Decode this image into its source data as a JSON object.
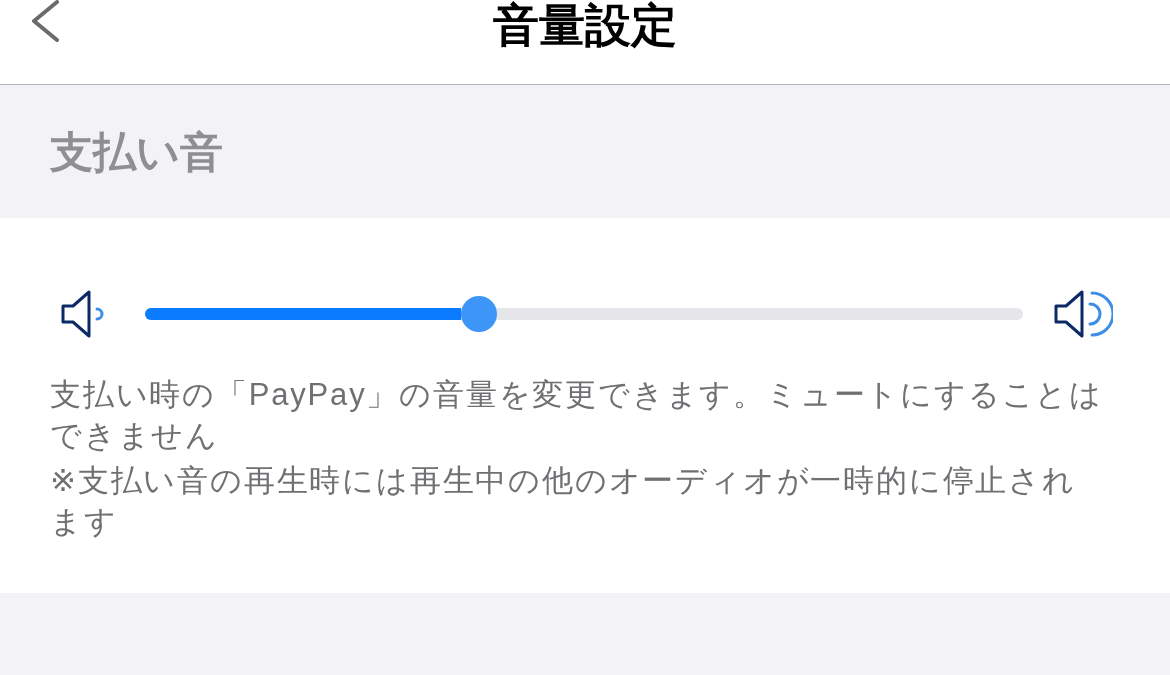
{
  "header": {
    "title": "音量設定"
  },
  "section": {
    "title": "支払い音"
  },
  "volume_slider": {
    "level": 0.38
  },
  "description": [
    "支払い時の「PayPay」の音量を変更できます。ミュートにすることはできません",
    "※支払い音の再生時には再生中の他のオーディオが一時的に停止されます"
  ]
}
